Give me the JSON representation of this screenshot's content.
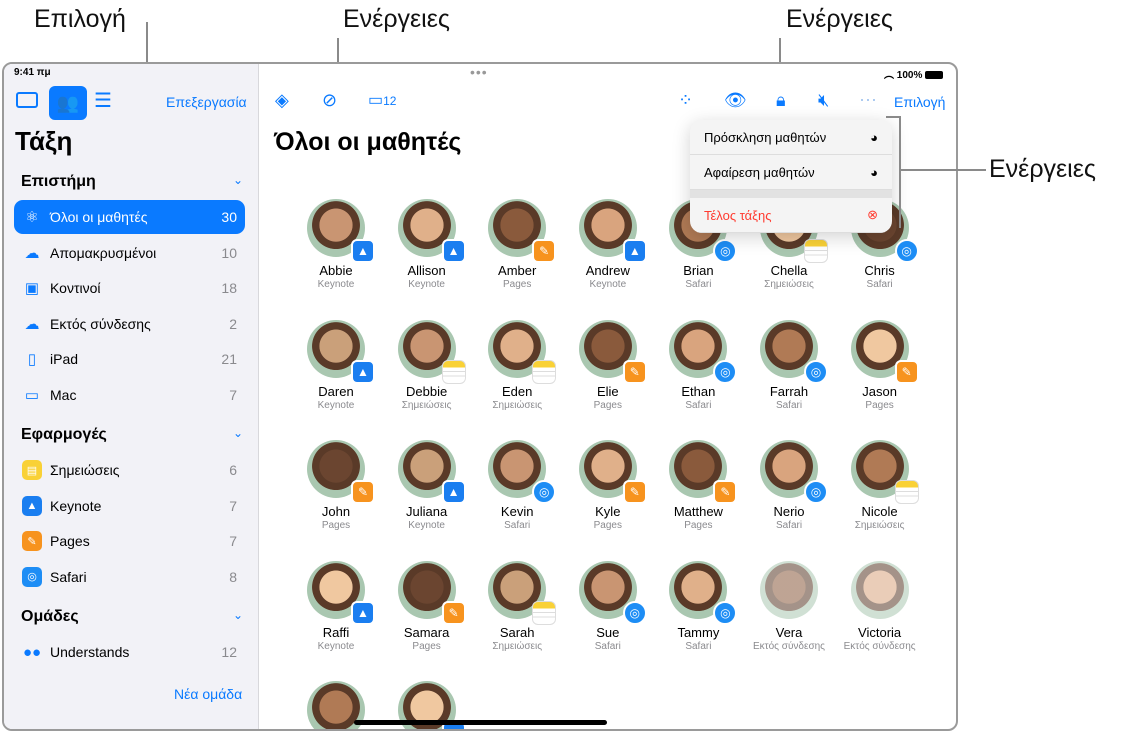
{
  "callouts": {
    "select": "Επιλογή",
    "actions_left": "Ενέργειες",
    "actions_right": "Ενέργειες",
    "actions_menu": "Ενέργειες"
  },
  "status": {
    "time": "9:41 πμ",
    "battery": "100%"
  },
  "sidebar": {
    "edit": "Επεξεργασία",
    "title": "Τάξη",
    "sections": [
      {
        "title": "Επιστήμη",
        "items": [
          {
            "label": "Όλοι οι μαθητές",
            "count": "30",
            "icon": "atom-icon",
            "selected": true
          },
          {
            "label": "Απομακρυσμένοι",
            "count": "10",
            "icon": "cloud-person-icon"
          },
          {
            "label": "Κοντινοί",
            "count": "18",
            "icon": "person-square-icon"
          },
          {
            "label": "Εκτός σύνδεσης",
            "count": "2",
            "icon": "cloud-slash-icon"
          },
          {
            "label": "iPad",
            "count": "21",
            "icon": "ipad-icon"
          },
          {
            "label": "Mac",
            "count": "7",
            "icon": "laptop-icon"
          }
        ]
      },
      {
        "title": "Εφαρμογές",
        "items": [
          {
            "label": "Σημειώσεις",
            "count": "6",
            "icon": "notes-icon"
          },
          {
            "label": "Keynote",
            "count": "7",
            "icon": "keynote-icon"
          },
          {
            "label": "Pages",
            "count": "7",
            "icon": "pages-icon"
          },
          {
            "label": "Safari",
            "count": "8",
            "icon": "safari-icon"
          }
        ]
      },
      {
        "title": "Ομάδες",
        "items": [
          {
            "label": "Understands",
            "count": "12",
            "icon": "group-avatars-icon"
          }
        ]
      }
    ],
    "new_group": "Νέα ομάδα"
  },
  "toolbar": {
    "inbox_count": "12",
    "select": "Επιλογή"
  },
  "main": {
    "title": "Όλοι οι μαθητές"
  },
  "menu": {
    "items": [
      {
        "label": "Πρόσκληση μαθητών",
        "icon": "add-student-icon"
      },
      {
        "label": "Αφαίρεση μαθητών",
        "icon": "remove-student-icon"
      },
      {
        "label": "Τέλος τάξης",
        "icon": "x-circle-icon",
        "destructive": true
      }
    ]
  },
  "students": [
    {
      "name": "Abbie",
      "app": "Keynote"
    },
    {
      "name": "Allison",
      "app": "Keynote"
    },
    {
      "name": "Amber",
      "app": "Pages"
    },
    {
      "name": "Andrew",
      "app": "Keynote"
    },
    {
      "name": "Brian",
      "app": "Safari"
    },
    {
      "name": "Chella",
      "app": "Σημειώσεις"
    },
    {
      "name": "Chris",
      "app": "Safari"
    },
    {
      "name": "Daren",
      "app": "Keynote"
    },
    {
      "name": "Debbie",
      "app": "Σημειώσεις"
    },
    {
      "name": "Eden",
      "app": "Σημειώσεις"
    },
    {
      "name": "Elie",
      "app": "Pages"
    },
    {
      "name": "Ethan",
      "app": "Safari"
    },
    {
      "name": "Farrah",
      "app": "Safari"
    },
    {
      "name": "Jason",
      "app": "Pages"
    },
    {
      "name": "John",
      "app": "Pages"
    },
    {
      "name": "Juliana",
      "app": "Keynote"
    },
    {
      "name": "Kevin",
      "app": "Safari"
    },
    {
      "name": "Kyle",
      "app": "Pages"
    },
    {
      "name": "Matthew",
      "app": "Pages"
    },
    {
      "name": "Nerio",
      "app": "Safari"
    },
    {
      "name": "Nicole",
      "app": "Σημειώσεις"
    },
    {
      "name": "Raffi",
      "app": "Keynote"
    },
    {
      "name": "Samara",
      "app": "Pages"
    },
    {
      "name": "Sarah",
      "app": "Σημειώσεις"
    },
    {
      "name": "Sue",
      "app": "Safari"
    },
    {
      "name": "Tammy",
      "app": "Safari"
    },
    {
      "name": "Vera",
      "app": "Εκτός σύνδεσης"
    },
    {
      "name": "Victoria",
      "app": "Εκτός σύνδεσης"
    },
    {
      "name": "",
      "app": ""
    },
    {
      "name": "",
      "app": "Keynote"
    }
  ],
  "colors": {
    "accent": "#0a7aff",
    "destructive": "#ff3b30",
    "sidebar_bg": "#f2f2f7"
  }
}
